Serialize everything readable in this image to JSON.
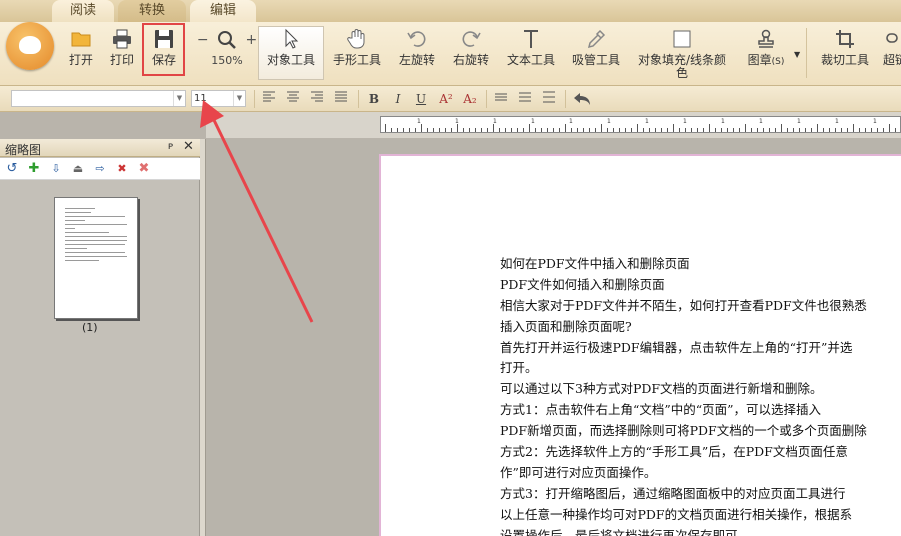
{
  "tabs": [
    {
      "label": "阅读"
    },
    {
      "label": "转换"
    },
    {
      "label": "编辑"
    }
  ],
  "toolbar": {
    "open": "打开",
    "print": "打印",
    "save": "保存",
    "zoom_minus": "−",
    "zoom_plus": "+",
    "zoom_level": "150%",
    "object_tool": "对象工具",
    "hand_tool": "手形工具",
    "rotate_left": "左旋转",
    "rotate_right": "右旋转",
    "text_tool": "文本工具",
    "eyedropper_tool": "吸管工具",
    "fill_line1": "对象填充/线条颜",
    "fill_line2": "色",
    "stamp": "图章",
    "stamp_hotkey": "(S)",
    "crop_tool": "裁切工具",
    "more_tool": "超链"
  },
  "format_bar": {
    "font_name": "",
    "font_size": "11",
    "bold": "B",
    "italic": "I",
    "underline": "U",
    "superscript": "A²",
    "subscript": "A₂"
  },
  "ruler": {
    "labels": [
      "1",
      "1",
      "1",
      "1",
      "1",
      "1",
      "1",
      "1",
      "1",
      "1",
      "1",
      "1",
      "1"
    ]
  },
  "panel": {
    "title": "缩略图",
    "pin": "ᴘ",
    "close": "✕",
    "thumbnail_label": "(1)"
  },
  "document": {
    "lines": [
      "如何在PDF文件中插入和删除页面",
      "PDF文件如何插入和删除页面",
      "相信大家对于PDF文件并不陌生，如何打开查看PDF文件也很熟悉",
      "插入页面和删除页面呢?",
      "首先打开并运行极速PDF编辑器，点击软件左上角的“打开”并选",
      "打开。",
      "可以通过以下3种方式对PDF文档的页面进行新增和删除。",
      "方式1：点击软件右上角“文档”中的“页面”，可以选择插入",
      "PDF新增页面，而选择删除则可将PDF文档的一个或多个页面删除",
      "方式2：先选择软件上方的“手形工具”后，在PDF文档页面任意",
      "作”即可进行对应页面操作。",
      "方式3：打开缩略图后，通过缩略图面板中的对应页面工具进行",
      "以上任意一种操作均可对PDF的文档页面进行相关操作，根据系",
      "设置操作后，最后将文档进行再次保存即可。"
    ]
  },
  "colors": {
    "annotation": "#e8454b",
    "ribbon": "#f4e8cd",
    "page_border": "#e2b4d6"
  },
  "icons": [
    "folder-icon",
    "printer-icon",
    "save-disk-icon",
    "magnifier-icon",
    "cursor-arrow-icon",
    "hand-icon",
    "rotate-left-icon",
    "rotate-right-icon",
    "text-t-icon",
    "eyedropper-icon",
    "fill-square-icon",
    "stamp-icon",
    "crop-icon",
    "undo-arrow-icon"
  ]
}
